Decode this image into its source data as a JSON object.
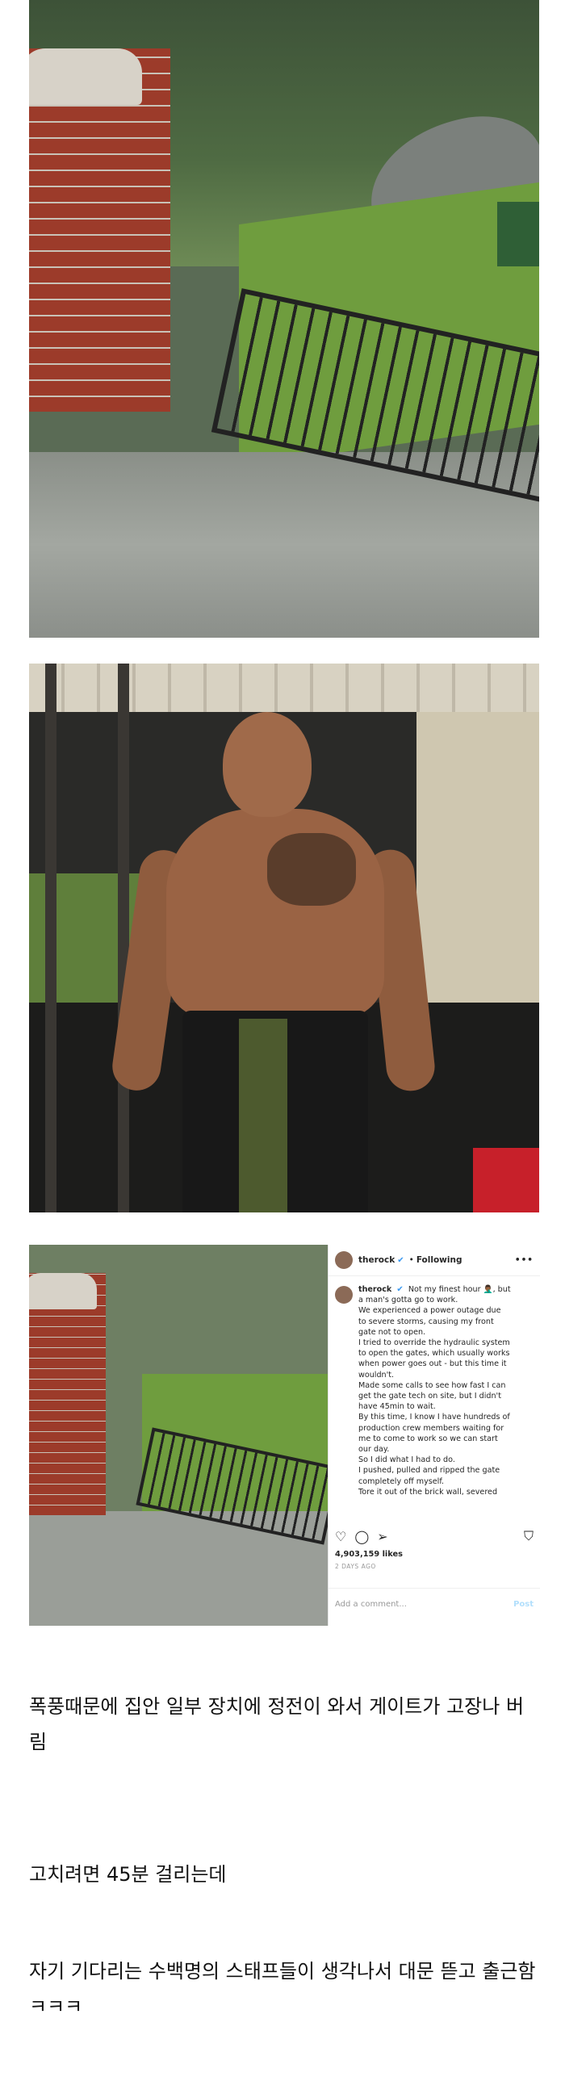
{
  "instagram": {
    "username": "therock",
    "verified_icon": "verified-badge-icon",
    "separator": "•",
    "follow_status": "Following",
    "more": "•••",
    "caption_lines": [
      "Not my finest hour 🤦🏾‍♂️, but",
      "a man's gotta go to work.",
      "We experienced a power outage due",
      "to severe storms, causing my front",
      "gate not to open.",
      "I tried to override the hydraulic system",
      "to open the gates, which usually works",
      "when power goes out - but this time it",
      "wouldn't.",
      "Made some calls to see how fast I can",
      "get the gate tech on site, but I didn't",
      "have 45min to wait.",
      "By this time, I know I have hundreds of",
      "production crew members waiting for",
      "me to come to work so we can start",
      "our day.",
      "So I did what I had to do.",
      "I pushed, pulled and ripped the gate",
      "completely off myself.",
      "Tore it out of the brick wall, severed"
    ],
    "likes": "4,903,159 likes",
    "time": "2 DAYS AGO",
    "comment_placeholder": "Add a comment...",
    "post_label": "Post",
    "action_icons": [
      "heart-icon",
      "comment-icon",
      "share-icon",
      "bookmark-icon"
    ]
  },
  "korean_text": {
    "p1": "폭풍때문에 집안 일부 장치에 정전이 와서 게이트가 고장나 버림",
    "p2": "고치려면 45분 걸리는데",
    "p3": "자기 기다리는 수백명의 스태프들이 생각나서 대문 뜯고 출근함 ㅋㅋㅋ"
  },
  "colors": {
    "instagram_link": "#3897f0",
    "background": "#ffffff"
  }
}
